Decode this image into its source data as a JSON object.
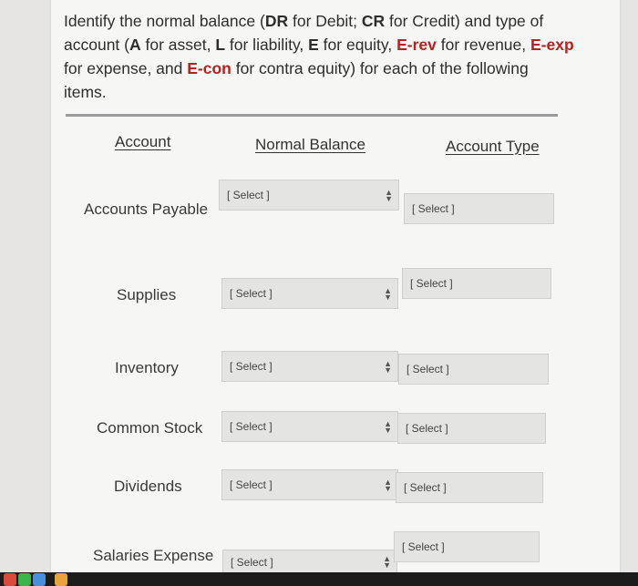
{
  "instructions": {
    "p1": "Identify the normal balance (",
    "dr": "DR",
    "p2": " for Debit; ",
    "cr": "CR",
    "p3": " for Credit) and type of account (",
    "a": "A",
    "p4": " for asset, ",
    "l": "L",
    "p5": " for liability, ",
    "e": "E",
    "p6": " for equity, ",
    "erev": "E-rev",
    "p7": " for revenue, ",
    "eexp": "E-exp",
    "p8": " for expense, and ",
    "econ": "E-con",
    "p9": " for contra equity) for each of the following items."
  },
  "headers": {
    "account": "Account",
    "normal_balance": "Normal Balance",
    "account_type": "Account Type"
  },
  "select_label": "[ Select ]",
  "rows": [
    {
      "account": "Accounts Payable",
      "normal_balance": "[ Select ]",
      "account_type": "[ Select ]"
    },
    {
      "account": "Supplies",
      "normal_balance": "[ Select ]",
      "account_type": "[ Select ]"
    },
    {
      "account": "Inventory",
      "normal_balance": "[ Select ]",
      "account_type": "[ Select ]"
    },
    {
      "account": "Common Stock",
      "normal_balance": "[ Select ]",
      "account_type": "[ Select ]"
    },
    {
      "account": "Dividends",
      "normal_balance": "[ Select ]",
      "account_type": "[ Select ]"
    },
    {
      "account": "Salaries Expense",
      "normal_balance": "[ Select ]",
      "account_type": "[ Select ]"
    }
  ]
}
